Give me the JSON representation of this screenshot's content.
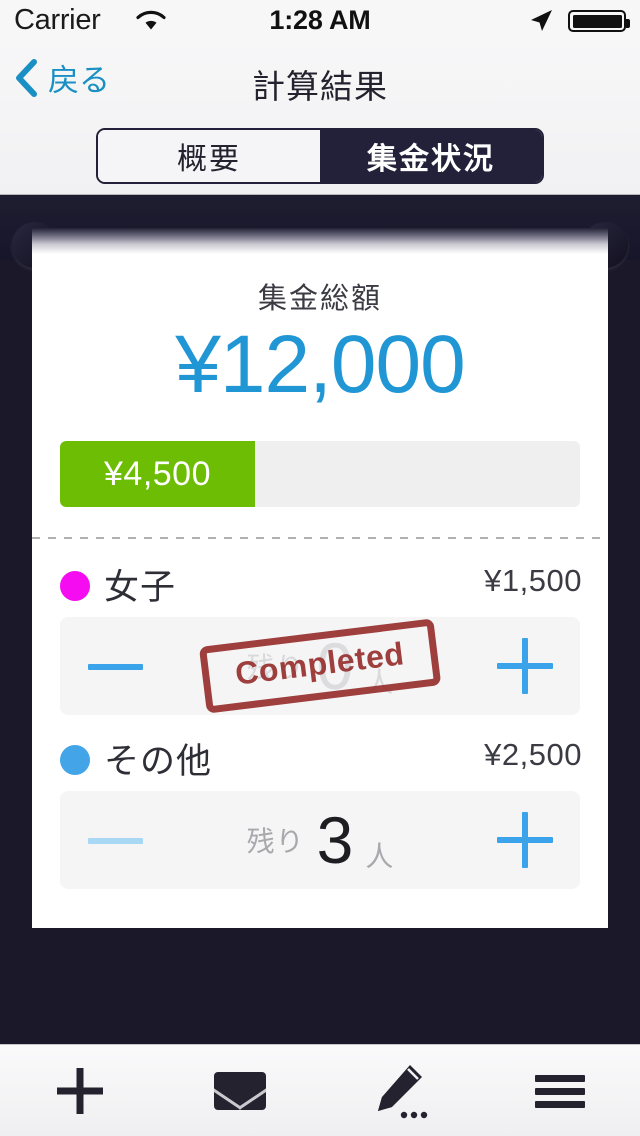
{
  "status_bar": {
    "carrier": "Carrier",
    "time": "1:28 AM",
    "wifi_icon": "wifi-icon",
    "location_icon": "location-arrow-icon",
    "battery_icon": "battery-full-icon"
  },
  "nav": {
    "back_label": "戻る",
    "back_icon": "chevron-left-icon",
    "title": "計算結果"
  },
  "segmented": {
    "selected_index": 1,
    "options": [
      {
        "label": "概要",
        "selected": false
      },
      {
        "label": "集金状況",
        "selected": true
      }
    ]
  },
  "summary": {
    "total_label": "集金総額",
    "total_amount": "¥12,000",
    "collected_amount": "¥4,500",
    "progress_percent": 37.5
  },
  "groups": [
    {
      "dot_color": "#f50cf0",
      "name": "女子",
      "amount": "¥1,500",
      "minus_label": "−",
      "plus_label": "+",
      "minus_enabled": true,
      "plus_enabled": true,
      "remaining_prefix": "残り",
      "remaining_count": "0",
      "remaining_suffix": "人",
      "completed": true,
      "stamp_label": "Completed"
    },
    {
      "dot_color": "#43a5e8",
      "name": "その他",
      "amount": "¥2,500",
      "minus_label": "−",
      "plus_label": "+",
      "minus_enabled": false,
      "plus_enabled": true,
      "remaining_prefix": "残り",
      "remaining_count": "3",
      "remaining_suffix": "人",
      "completed": false,
      "stamp_label": ""
    }
  ],
  "toolbar": {
    "items": [
      {
        "icon": "plus-icon",
        "label": ""
      },
      {
        "icon": "envelope-icon",
        "label": ""
      },
      {
        "icon": "pencil-edit-icon",
        "label": ""
      },
      {
        "icon": "hamburger-menu-icon",
        "label": ""
      }
    ]
  },
  "colors": {
    "accent_blue": "#2196d4",
    "progress_green": "#6ebd05",
    "dark_navy": "#23203a",
    "stamp_red": "#97302f"
  }
}
